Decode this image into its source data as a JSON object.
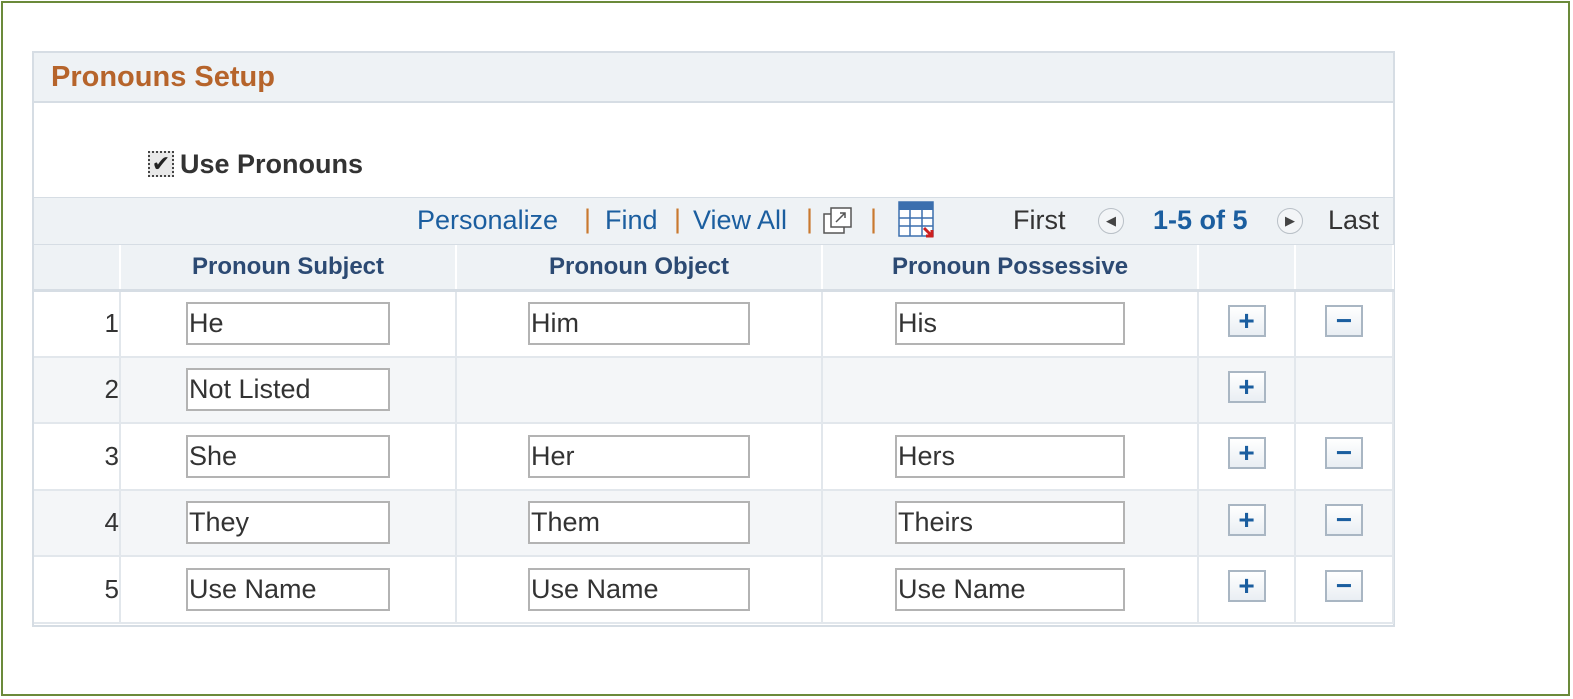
{
  "section": {
    "title": "Pronouns Setup"
  },
  "use_pronouns": {
    "label": "Use Pronouns",
    "checked": true
  },
  "nav": {
    "personalize": "Personalize",
    "find": "Find",
    "view_all": "View All",
    "separator": "|",
    "first": "First",
    "range": "1-5 of 5",
    "last": "Last",
    "zoom_icon": "new-window-icon",
    "grid_icon": "download-grid-icon",
    "prev_icon": "prev-arrow-icon",
    "next_icon": "next-arrow-icon"
  },
  "columns": [
    "Pronoun Subject",
    "Pronoun Object",
    "Pronoun Possessive"
  ],
  "rows": [
    {
      "num": "1",
      "subject": "He",
      "object": "Him",
      "possessive": "His",
      "add": "+",
      "delete": "−"
    },
    {
      "num": "2",
      "subject": "Not Listed",
      "object": null,
      "possessive": null,
      "add": "+",
      "delete": null
    },
    {
      "num": "3",
      "subject": "She",
      "object": "Her",
      "possessive": "Hers",
      "add": "+",
      "delete": "−"
    },
    {
      "num": "4",
      "subject": "They",
      "object": "Them",
      "possessive": "Theirs",
      "add": "+",
      "delete": "−"
    },
    {
      "num": "5",
      "subject": "Use Name",
      "object": "Use Name",
      "possessive": "Use Name",
      "add": "+",
      "delete": "−"
    }
  ],
  "colors": {
    "frame_border": "#6b8a3a",
    "title": "#b6642b",
    "link": "#1b5e9f",
    "header_text": "#2c4a73",
    "panel_bg": "#eef2f5"
  }
}
